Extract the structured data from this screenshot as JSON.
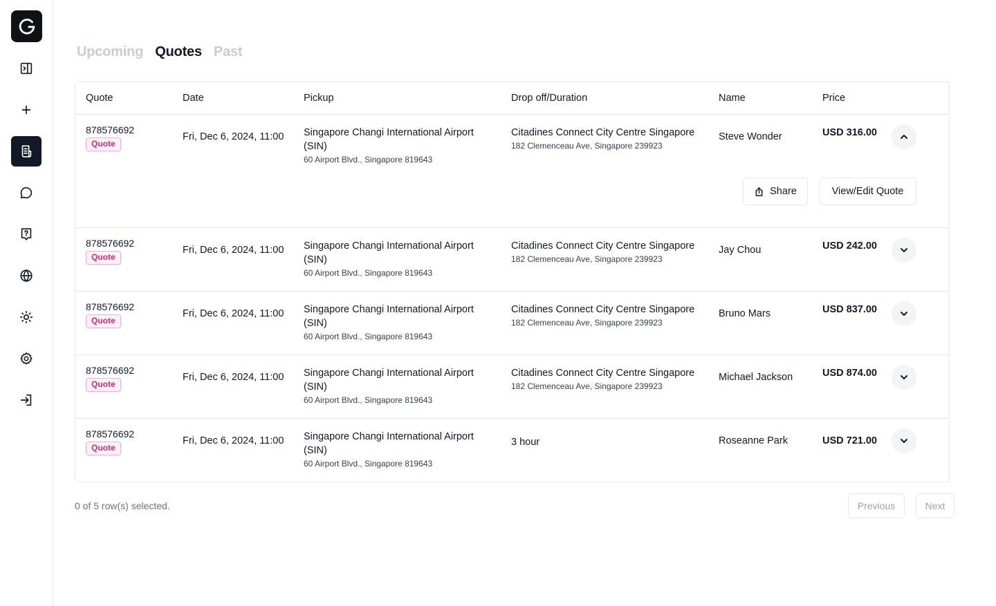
{
  "sidebar": {
    "items": [
      {
        "name": "panel-toggle-icon"
      },
      {
        "name": "plus-icon"
      },
      {
        "name": "receipt-icon"
      },
      {
        "name": "chat-bubble-icon"
      },
      {
        "name": "help-icon"
      },
      {
        "name": "globe-icon"
      },
      {
        "name": "sun-icon"
      },
      {
        "name": "gear-icon"
      },
      {
        "name": "log-in-icon"
      }
    ],
    "active_index": 2
  },
  "tabs": [
    {
      "label": "Upcoming",
      "active": false
    },
    {
      "label": "Quotes",
      "active": true
    },
    {
      "label": "Past",
      "active": false
    }
  ],
  "table": {
    "headers": {
      "quote": "Quote",
      "date": "Date",
      "pickup": "Pickup",
      "dropoff": "Drop off/Duration",
      "name": "Name",
      "price": "Price"
    },
    "rows": [
      {
        "id": "878576692",
        "badge": "Quote",
        "date": "Fri, Dec 6, 2024, 11:00",
        "pickup_name": "Singapore Changi International Airport (SIN)",
        "pickup_addr": "60 Airport Blvd., Singapore 819643",
        "dropoff_name": "Citadines Connect City Centre Singapore",
        "dropoff_addr": "182 Clemenceau Ave, Singapore 239923",
        "name": "Steve Wonder",
        "price": "USD 316.00",
        "expanded": true
      },
      {
        "id": "878576692",
        "badge": "Quote",
        "date": "Fri, Dec 6, 2024, 11:00",
        "pickup_name": "Singapore Changi International Airport (SIN)",
        "pickup_addr": "60 Airport Blvd., Singapore 819643",
        "dropoff_name": "Citadines Connect City Centre Singapore",
        "dropoff_addr": "182 Clemenceau Ave, Singapore 239923",
        "name": "Jay Chou",
        "price": "USD 242.00",
        "expanded": false
      },
      {
        "id": "878576692",
        "badge": "Quote",
        "date": "Fri, Dec 6, 2024, 11:00",
        "pickup_name": "Singapore Changi International Airport (SIN)",
        "pickup_addr": "60 Airport Blvd., Singapore 819643",
        "dropoff_name": "Citadines Connect City Centre Singapore",
        "dropoff_addr": "182 Clemenceau Ave, Singapore 239923",
        "name": "Bruno Mars",
        "price": "USD 837.00",
        "expanded": false
      },
      {
        "id": "878576692",
        "badge": "Quote",
        "date": "Fri, Dec 6, 2024, 11:00",
        "pickup_name": "Singapore Changi International Airport (SIN)",
        "pickup_addr": "60 Airport Blvd., Singapore 819643",
        "dropoff_name": "Citadines Connect City Centre Singapore",
        "dropoff_addr": "182 Clemenceau Ave, Singapore 239923",
        "name": "Michael Jackson",
        "price": "USD 874.00",
        "expanded": false
      },
      {
        "id": "878576692",
        "badge": "Quote",
        "date": "Fri, Dec 6, 2024, 11:00",
        "pickup_name": "Singapore Changi International Airport (SIN)",
        "pickup_addr": "60 Airport Blvd., Singapore 819643",
        "dropoff_name": "3 hour",
        "dropoff_addr": "",
        "name": "Roseanne Park",
        "price": "USD 721.00",
        "expanded": false
      }
    ],
    "expanded_actions": {
      "share_label": "Share",
      "view_edit_label": "View/Edit Quote"
    }
  },
  "footer": {
    "selection_text": "0 of 5 row(s) selected.",
    "previous_label": "Previous",
    "next_label": "Next"
  },
  "colors": {
    "accent": "#111827",
    "badge_text": "#db2777",
    "badge_bg": "#fdf2f8",
    "badge_border": "#f9a8d4"
  }
}
